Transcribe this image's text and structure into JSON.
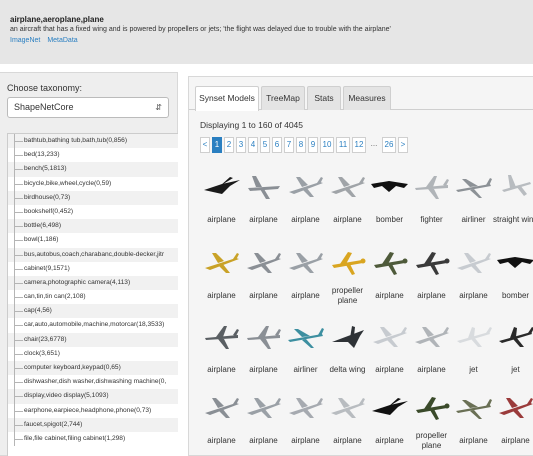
{
  "synset": {
    "title": "airplane,aeroplane,plane",
    "gloss": "an aircraft that has a fixed wing and is powered by propellers or jets; 'the flight was delayed due to trouble with the airplane'",
    "links": [
      "ImageNet",
      "MetaData"
    ]
  },
  "taxonomy": {
    "label": "Choose taxonomy:",
    "selected": "ShapeNetCore",
    "items": [
      "bathtub,bathing tub,bath,tub(0,856)",
      "bed(13,233)",
      "bench(5,1813)",
      "bicycle,bike,wheel,cycle(0,59)",
      "birdhouse(0,73)",
      "bookshelf(0,452)",
      "bottle(6,498)",
      "bowl(1,186)",
      "bus,autobus,coach,charabanc,double-decker,jitr",
      "cabinet(9,1571)",
      "camera,photographic camera(4,113)",
      "can,tin,tin can(2,108)",
      "cap(4,56)",
      "car,auto,automobile,machine,motorcar(18,3533)",
      "chair(23,6778)",
      "clock(3,651)",
      "computer keyboard,keypad(0,65)",
      "dishwasher,dish washer,dishwashing machine(0,",
      "display,video display(5,1093)",
      "earphone,earpiece,headphone,phone(0,73)",
      "faucet,spigot(2,744)",
      "file,file cabinet,filing cabinet(1,298)"
    ]
  },
  "tabs": [
    "Synset Models",
    "TreeMap",
    "Stats",
    "Measures"
  ],
  "results": {
    "displaying": "Displaying 1 to 160 of 4045"
  },
  "pagination": {
    "prev": "<",
    "pages": [
      "1",
      "2",
      "3",
      "4",
      "5",
      "6",
      "7",
      "8",
      "9",
      "10",
      "11",
      "12"
    ],
    "ellipsis": "...",
    "last": "26",
    "next": ">"
  },
  "models": [
    {
      "label": "airplane",
      "color": "#1a1a1a",
      "icon": "dark-delta-jet-icon"
    },
    {
      "label": "airplane",
      "color": "#8a8f95",
      "icon": "x-wing-fighter-icon"
    },
    {
      "label": "airplane",
      "color": "#9aa0a6",
      "icon": "jet-airplane-icon"
    },
    {
      "label": "airplane",
      "color": "#a0a4a8",
      "icon": "jet-airplane-icon"
    },
    {
      "label": "bomber",
      "color": "#111111",
      "icon": "flying-wing-bomber-icon"
    },
    {
      "label": "fighter",
      "color": "#b0b4b8",
      "icon": "fighter-jet-icon"
    },
    {
      "label": "airliner",
      "color": "#8c9196",
      "icon": "airliner-icon"
    },
    {
      "label": "straight wing",
      "color": "#b8bcc0",
      "icon": "straight-wing-plane-icon"
    },
    {
      "label": "airplane",
      "color": "#c9a227",
      "icon": "jet-airplane-icon"
    },
    {
      "label": "airplane",
      "color": "#8a8f95",
      "icon": "jet-airplane-icon"
    },
    {
      "label": "airplane",
      "color": "#9aa0a6",
      "icon": "jet-airplane-icon"
    },
    {
      "label": "propeller plane",
      "color": "#d9a520",
      "icon": "propeller-plane-icon"
    },
    {
      "label": "airplane",
      "color": "#4e5a3a",
      "icon": "propeller-plane-icon"
    },
    {
      "label": "airplane",
      "color": "#3a3a3a",
      "icon": "propeller-plane-icon"
    },
    {
      "label": "airplane",
      "color": "#c7cbd0",
      "icon": "jet-airplane-icon"
    },
    {
      "label": "bomber",
      "color": "#111111",
      "icon": "flying-wing-bomber-icon"
    },
    {
      "label": "airplane",
      "color": "#5a5f63",
      "icon": "fighter-jet-icon"
    },
    {
      "label": "airplane",
      "color": "#8a8f95",
      "icon": "fighter-jet-icon"
    },
    {
      "label": "airliner",
      "color": "#3d8fa0",
      "icon": "airliner-icon"
    },
    {
      "label": "delta wing",
      "color": "#2e3236",
      "icon": "delta-wing-icon"
    },
    {
      "label": "airplane",
      "color": "#c7cbd0",
      "icon": "jet-airplane-icon"
    },
    {
      "label": "airplane",
      "color": "#b0b4b8",
      "icon": "jet-airplane-icon"
    },
    {
      "label": "jet",
      "color": "#d8dbde",
      "icon": "jet-icon"
    },
    {
      "label": "jet",
      "color": "#2a2a2a",
      "icon": "jet-icon"
    },
    {
      "label": "airplane",
      "color": "#8a8f95",
      "icon": "jet-airplane-icon"
    },
    {
      "label": "airplane",
      "color": "#9aa0a6",
      "icon": "jet-airplane-icon"
    },
    {
      "label": "airplane",
      "color": "#a6aab0",
      "icon": "jet-airplane-icon"
    },
    {
      "label": "airplane",
      "color": "#b8bcc0",
      "icon": "jet-airplane-icon"
    },
    {
      "label": "airplane",
      "color": "#111111",
      "icon": "dark-delta-jet-icon"
    },
    {
      "label": "propeller plane",
      "color": "#3a4a2a",
      "icon": "propeller-plane-icon"
    },
    {
      "label": "airplane",
      "color": "#6a7055",
      "icon": "airliner-icon"
    },
    {
      "label": "airplane",
      "color": "#9a3b3b",
      "icon": "jet-airplane-icon"
    }
  ]
}
